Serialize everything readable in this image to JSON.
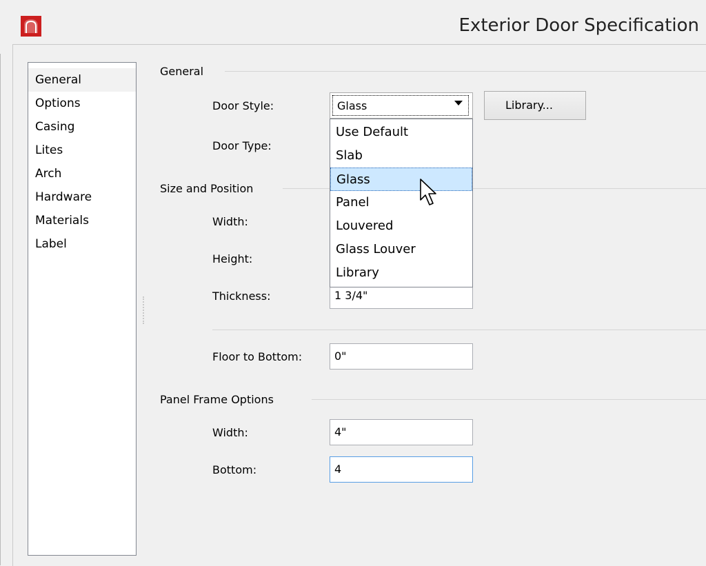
{
  "window": {
    "title": "Exterior Door Specification",
    "app_icon": "app-logo-icon",
    "accent_color": "#cc1f1f"
  },
  "nav": {
    "items": [
      {
        "label": "General",
        "selected": true
      },
      {
        "label": "Options"
      },
      {
        "label": "Casing"
      },
      {
        "label": "Lites"
      },
      {
        "label": "Arch"
      },
      {
        "label": "Hardware"
      },
      {
        "label": "Materials"
      },
      {
        "label": "Label"
      }
    ]
  },
  "general": {
    "header": "General",
    "door_style_label": "Door Style:",
    "door_style_value": "Glass",
    "library_button": "Library...",
    "door_type_label": "Door Type:"
  },
  "door_style_dropdown": {
    "options": [
      "Use Default",
      "Slab",
      "Glass",
      "Panel",
      "Louvered",
      "Glass Louver",
      "Library"
    ],
    "highlighted": "Glass"
  },
  "size_position": {
    "header": "Size and Position",
    "width_label": "Width:",
    "height_label": "Height:",
    "thickness_label": "Thickness:",
    "thickness_value": "1 3/4\"",
    "floor_to_bottom_label": "Floor to Bottom:",
    "floor_to_bottom_value": "0\""
  },
  "panel_frame": {
    "header": "Panel Frame Options",
    "width_label": "Width:",
    "width_value": "4\"",
    "bottom_label": "Bottom:",
    "bottom_value": "4"
  }
}
